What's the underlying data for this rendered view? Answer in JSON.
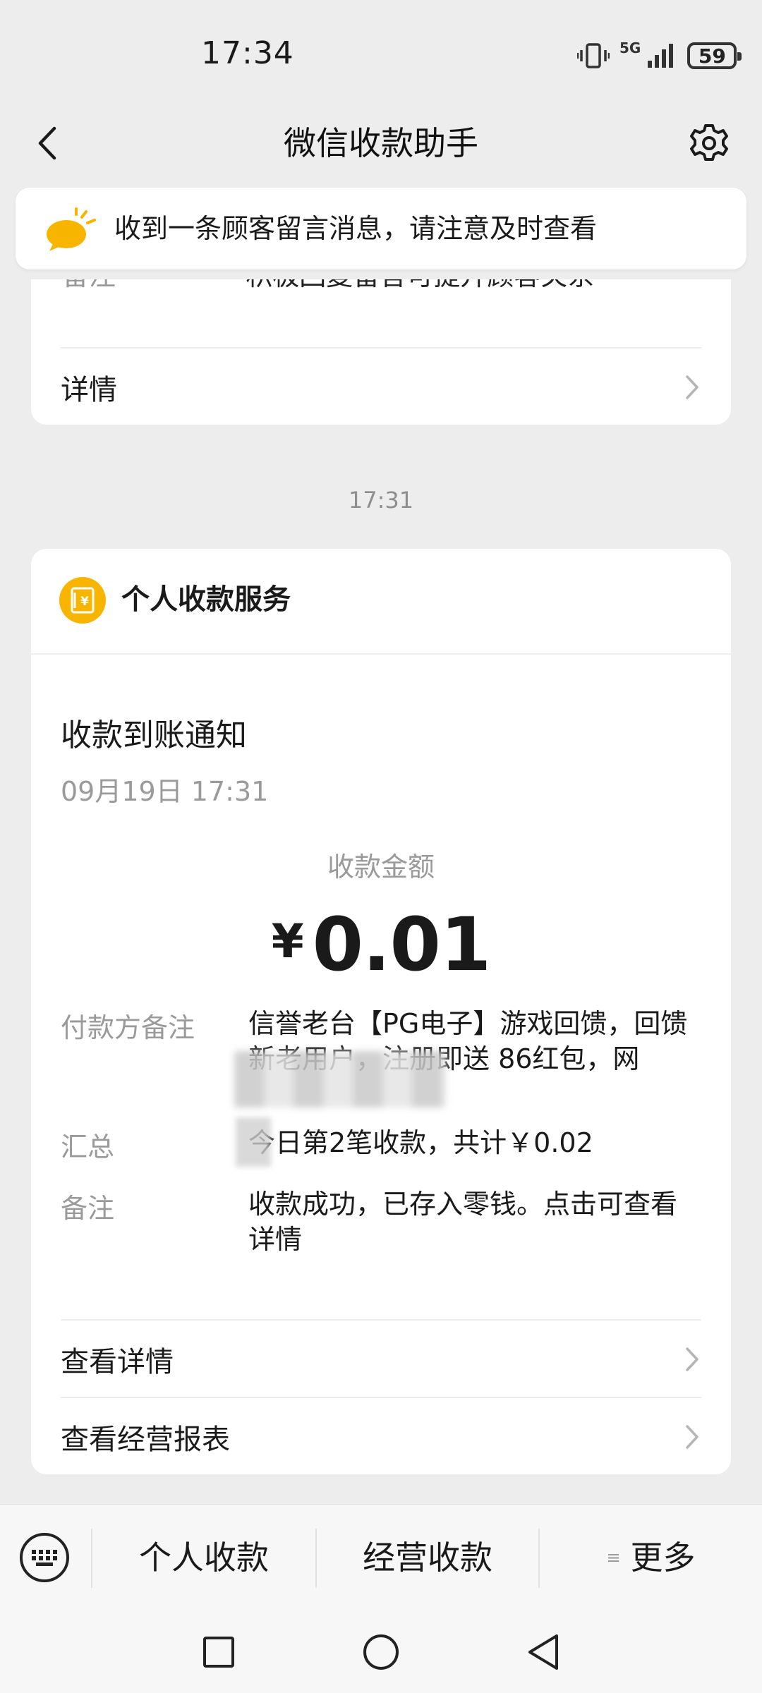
{
  "status_bar": {
    "time": "17:34",
    "network": "5G",
    "battery": "59"
  },
  "nav": {
    "title": "微信收款助手"
  },
  "notice": {
    "text": "收到一条顾客留言消息，请注意及时查看"
  },
  "top_card": {
    "clipped_label": "备注",
    "clipped_value": "积极回复留言可提升顾客关系",
    "link_label": "详情"
  },
  "timestamp": "17:31",
  "card": {
    "service_name": "个人收款服务",
    "service_icon_symbol": "¥",
    "title": "收款到账通知",
    "datetime": "09月19日 17:31",
    "amount_label": "收款金额",
    "currency": "¥",
    "amount": "0.01",
    "rows": [
      {
        "label": "付款方备注",
        "value": "信誉老台【PG电子】游戏回馈，回馈新老用户，注册即送 86红包，网"
      },
      {
        "label": "汇总",
        "value": "今日第2笔收款，共计￥0.02"
      },
      {
        "label": "备注",
        "value": "收款成功，已存入零钱。点击可查看详情"
      }
    ],
    "links": [
      {
        "label": "查看详情"
      },
      {
        "label": "查看经营报表"
      }
    ]
  },
  "bottom_bar": {
    "menus": [
      {
        "label": "个人收款"
      },
      {
        "label": "经营收款"
      },
      {
        "label": "更多"
      }
    ]
  },
  "colors": {
    "accent": "#f7b500",
    "background": "#ededed",
    "card": "#ffffff",
    "muted_text": "#9a9a9a"
  }
}
